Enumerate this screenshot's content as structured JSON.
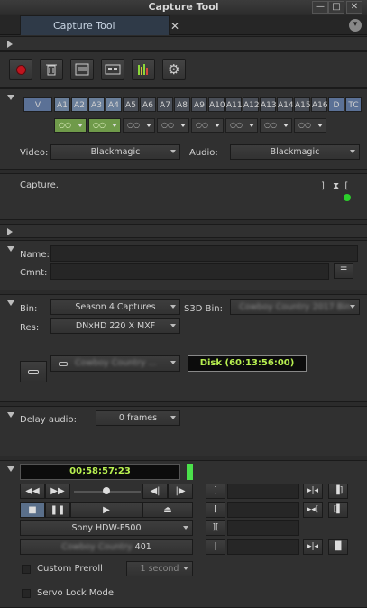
{
  "window": {
    "title": "Capture Tool",
    "min_label": "—",
    "max_label": "□",
    "close_label": "✕"
  },
  "tab": {
    "label": "Capture Tool",
    "close_label": "✕"
  },
  "status": {
    "text": "Capture."
  },
  "tracks": [
    "V",
    "A1",
    "A2",
    "A3",
    "A4",
    "A5",
    "A6",
    "A7",
    "A8",
    "A9",
    "A10",
    "A11",
    "A12",
    "A13",
    "A14",
    "A15",
    "A16",
    "D",
    "TC"
  ],
  "video": {
    "label": "Video:",
    "value": "Blackmagic"
  },
  "audio": {
    "label": "Audio:",
    "value": "Blackmagic"
  },
  "name": {
    "label": "Name:",
    "value": ""
  },
  "cmnt": {
    "label": "Cmnt:",
    "value": ""
  },
  "bin": {
    "label": "Bin:",
    "value": "Season 4 Captures"
  },
  "s3d_bin": {
    "label": "S3D Bin:",
    "value": "Cowboy Country 2017 Bin"
  },
  "res": {
    "label": "Res:",
    "value": "DNxHD 220 X  MXF"
  },
  "target": {
    "value": "Cowboy Country ..."
  },
  "disk": {
    "value": "Disk (60:13:56:00)"
  },
  "delay": {
    "label": "Delay audio:",
    "value": "0 frames"
  },
  "timecode": {
    "value": "00;58;57;23"
  },
  "deck": {
    "value": "Sony HDW-F500"
  },
  "tape": {
    "name": "Cowboy Country",
    "number": "401"
  },
  "preroll": {
    "label": "Custom Preroll",
    "value": "1 second"
  },
  "servo": {
    "label": "Servo Lock Mode"
  },
  "colors": {
    "record": "#c0141e",
    "accent_green": "#8bd63a",
    "track_on": "#6a7f9a"
  }
}
